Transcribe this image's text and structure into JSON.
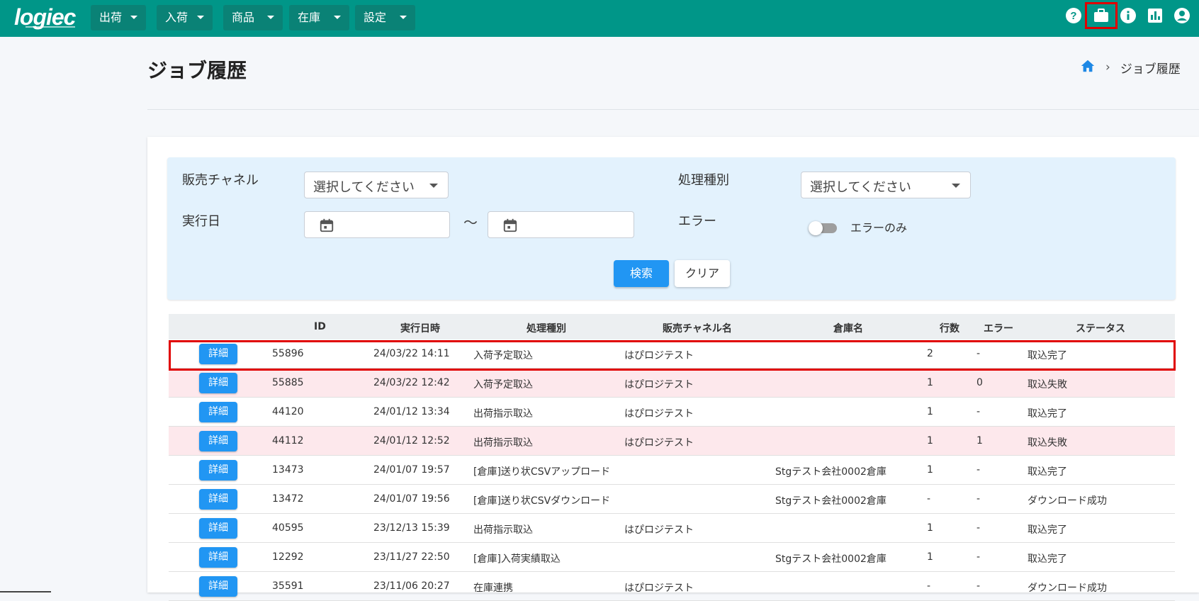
{
  "app": {
    "logo": "logiec"
  },
  "nav": {
    "menus": [
      {
        "label": "出荷"
      },
      {
        "label": "入荷"
      },
      {
        "label": "商品"
      },
      {
        "label": "在庫"
      },
      {
        "label": "設定"
      }
    ],
    "icons": [
      "help-icon",
      "briefcase-icon",
      "info-icon",
      "chart-icon",
      "account-icon"
    ]
  },
  "page": {
    "title": "ジョブ履歴",
    "breadcrumb": [
      "home-icon",
      "ジョブ履歴"
    ]
  },
  "search": {
    "channel_label": "販売チャネル",
    "channel_value": "選択してください",
    "process_label": "処理種別",
    "process_value": "選択してください",
    "date_label": "実行日",
    "date_separator": "～",
    "error_label": "エラー",
    "error_toggle_label": "エラーのみ",
    "search_button": "検索",
    "clear_button": "クリア"
  },
  "table": {
    "columns": [
      "ID",
      "実行日時",
      "処理種別",
      "販売チャネル名",
      "倉庫名",
      "行数",
      "エラー",
      "ステータス"
    ],
    "detail_label": "詳細",
    "rows": [
      {
        "id": "55896",
        "datetime": "24/03/22 14:11",
        "type": "入荷予定取込",
        "channel": "はぴロジテスト",
        "warehouse": "",
        "lines": "2",
        "error": "-",
        "status": "取込完了",
        "is_error": false
      },
      {
        "id": "55885",
        "datetime": "24/03/22 12:42",
        "type": "入荷予定取込",
        "channel": "はぴロジテスト",
        "warehouse": "",
        "lines": "1",
        "error": "0",
        "status": "取込失敗",
        "is_error": true
      },
      {
        "id": "44120",
        "datetime": "24/01/12 13:34",
        "type": "出荷指示取込",
        "channel": "はぴロジテスト",
        "warehouse": "",
        "lines": "1",
        "error": "-",
        "status": "取込完了",
        "is_error": false
      },
      {
        "id": "44112",
        "datetime": "24/01/12 12:52",
        "type": "出荷指示取込",
        "channel": "はぴロジテスト",
        "warehouse": "",
        "lines": "1",
        "error": "1",
        "status": "取込失敗",
        "is_error": true
      },
      {
        "id": "13473",
        "datetime": "24/01/07 19:57",
        "type": "[倉庫]送り状CSVアップロード",
        "channel": "",
        "warehouse": "Stgテスト会社0002倉庫",
        "lines": "1",
        "error": "-",
        "status": "取込完了",
        "is_error": false
      },
      {
        "id": "13472",
        "datetime": "24/01/07 19:56",
        "type": "[倉庫]送り状CSVダウンロード",
        "channel": "",
        "warehouse": "Stgテスト会社0002倉庫",
        "lines": "-",
        "error": "-",
        "status": "ダウンロード成功",
        "is_error": false
      },
      {
        "id": "40595",
        "datetime": "23/12/13 15:39",
        "type": "出荷指示取込",
        "channel": "はぴロジテスト",
        "warehouse": "",
        "lines": "1",
        "error": "-",
        "status": "取込完了",
        "is_error": false
      },
      {
        "id": "12292",
        "datetime": "23/11/27 22:50",
        "type": "[倉庫]入荷実績取込",
        "channel": "",
        "warehouse": "Stgテスト会社0002倉庫",
        "lines": "1",
        "error": "-",
        "status": "取込完了",
        "is_error": false
      },
      {
        "id": "35591",
        "datetime": "23/11/06 20:27",
        "type": "在庫連携",
        "channel": "はぴロジテスト",
        "warehouse": "",
        "lines": "-",
        "error": "-",
        "status": "ダウンロード成功",
        "is_error": false
      }
    ]
  },
  "colors": {
    "header": "#009688",
    "primary": "#2196f3",
    "error_row": "#fde8ec",
    "highlight": "#e00000"
  }
}
